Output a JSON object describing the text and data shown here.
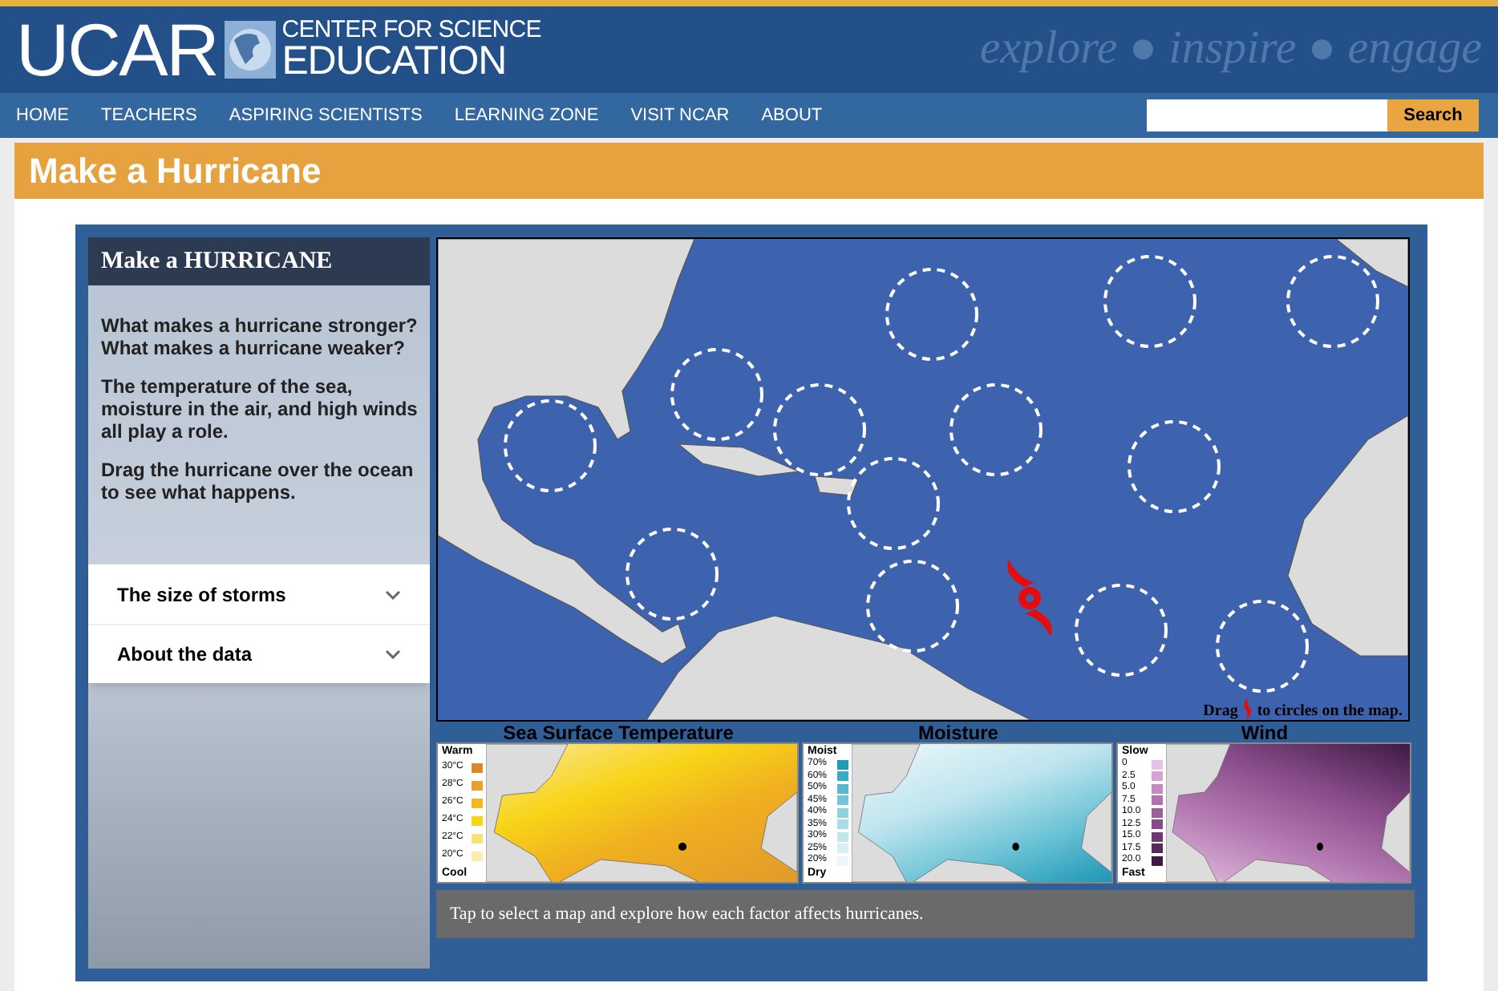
{
  "header": {
    "logo": "UCAR",
    "subtitle": [
      "CENTER FOR SCIENCE",
      "EDUCATION"
    ],
    "tagline": "explore ● inspire ● engage"
  },
  "nav": {
    "items": [
      "HOME",
      "TEACHERS",
      "ASPIRING SCIENTISTS",
      "LEARNING ZONE",
      "VISIT NCAR",
      "ABOUT"
    ],
    "search_button": "Search"
  },
  "page_title": "Make a Hurricane",
  "panel": {
    "title": "Make a HURRICANE",
    "paragraphs": [
      [
        "What makes a hurricane stronger?",
        "What makes a hurricane weaker?"
      ],
      [
        "The temperature of the sea, moisture in the air, and high winds all play a role."
      ],
      [
        "Drag the hurricane over the ocean to see what happens."
      ]
    ],
    "accordion": [
      {
        "label": "The size of storms",
        "expanded": false
      },
      {
        "label": "About the data",
        "expanded": false
      }
    ]
  },
  "map": {
    "caption_before": "Drag",
    "caption_after": "to circles on the map."
  },
  "factor_maps": [
    {
      "kind": "temperature",
      "title": "Sea Surface Temperature",
      "top": "Warm",
      "bottom": "Cool",
      "legend": [
        {
          "label": "30°C",
          "color": "#d9892a"
        },
        {
          "label": "28°C",
          "color": "#e9a12a"
        },
        {
          "label": "26°C",
          "color": "#f4b81e"
        },
        {
          "label": "24°C",
          "color": "#f8d418"
        },
        {
          "label": "22°C",
          "color": "#f7e27a"
        },
        {
          "label": "20°C",
          "color": "#f9edb0"
        }
      ]
    },
    {
      "kind": "moisture",
      "title": "Moisture",
      "top": "Moist",
      "bottom": "Dry",
      "legend": [
        {
          "label": "70%",
          "color": "#1f9ab8"
        },
        {
          "label": "60%",
          "color": "#3aaac4"
        },
        {
          "label": "50%",
          "color": "#56b8cf"
        },
        {
          "label": "45%",
          "color": "#74c5d8"
        },
        {
          "label": "40%",
          "color": "#90d1e0"
        },
        {
          "label": "35%",
          "color": "#a9dce8"
        },
        {
          "label": "30%",
          "color": "#c2e6ef"
        },
        {
          "label": "25%",
          "color": "#d8eff5"
        },
        {
          "label": "20%",
          "color": "#ecf7fa"
        }
      ]
    },
    {
      "kind": "wind",
      "title": "Wind",
      "top": "Slow",
      "bottom": "Fast",
      "legend": [
        {
          "label": "0",
          "color": "#e6c3e4"
        },
        {
          "label": "2.5",
          "color": "#d4a5d2"
        },
        {
          "label": "5.0",
          "color": "#c28bc1"
        },
        {
          "label": "7.5",
          "color": "#b073b0"
        },
        {
          "label": "10.0",
          "color": "#9c5e9e"
        },
        {
          "label": "12.5",
          "color": "#864a89"
        },
        {
          "label": "15.0",
          "color": "#6e3872"
        },
        {
          "label": "17.5",
          "color": "#56285b"
        },
        {
          "label": "20.0",
          "color": "#3e1a44"
        }
      ]
    }
  ],
  "footer_caption": "Tap to select a map and explore how each factor affects hurricanes."
}
